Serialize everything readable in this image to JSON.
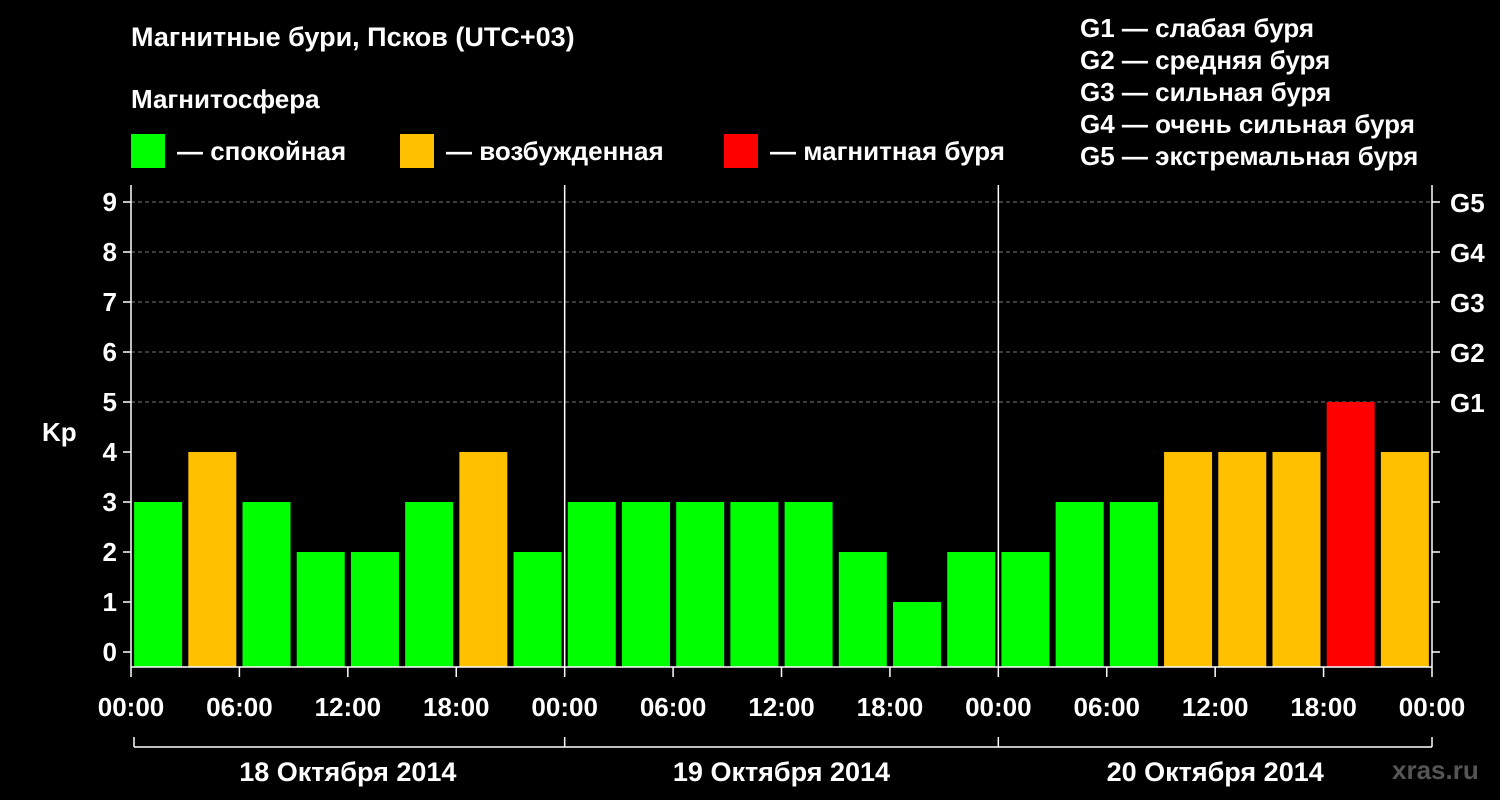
{
  "title": "Магнитные бури, Псков (UTC+03)",
  "subtitle": "Магнитосфера",
  "legend": [
    {
      "label": "— спокойная",
      "color": "#00ff00"
    },
    {
      "label": "— возбужденная",
      "color": "#ffc000"
    },
    {
      "label": "— магнитная буря",
      "color": "#ff0000"
    }
  ],
  "g_levels": [
    "G1 — слабая буря",
    "G2 — средняя буря",
    "G3 — сильная буря",
    "G4 — очень сильная буря",
    "G5 — экстремальная буря"
  ],
  "watermark": "xras.ru",
  "chart_data": {
    "type": "bar",
    "ylabel": "Kp",
    "ylim": [
      0,
      9
    ],
    "y_ticks": [
      0,
      1,
      2,
      3,
      4,
      5,
      6,
      7,
      8,
      9
    ],
    "right_axis_labels": [
      {
        "kp": 5,
        "label": "G1"
      },
      {
        "kp": 6,
        "label": "G2"
      },
      {
        "kp": 7,
        "label": "G3"
      },
      {
        "kp": 8,
        "label": "G4"
      },
      {
        "kp": 9,
        "label": "G5"
      }
    ],
    "x_tick_labels": [
      "00:00",
      "06:00",
      "12:00",
      "18:00",
      "00:00",
      "06:00",
      "12:00",
      "18:00",
      "00:00",
      "06:00",
      "12:00",
      "18:00",
      "00:00"
    ],
    "days": [
      "18 Октября 2014",
      "19 Октября 2014",
      "20 Октября 2014"
    ],
    "values": [
      3,
      4,
      3,
      2,
      2,
      3,
      4,
      2,
      3,
      3,
      3,
      3,
      3,
      2,
      1,
      2,
      2,
      3,
      3,
      4,
      4,
      4,
      5,
      4
    ],
    "colors": {
      "calm": "#00ff00",
      "active": "#ffc000",
      "storm": "#ff0000"
    },
    "grid": "dashed horizontal at Kp 5-9"
  }
}
